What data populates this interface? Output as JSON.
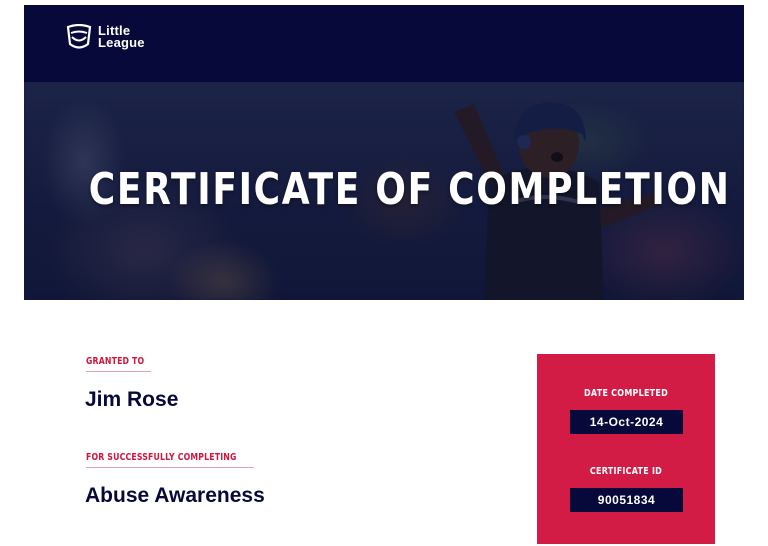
{
  "header": {
    "logo_line1": "Little",
    "logo_line2": "League"
  },
  "hero": {
    "title": "CERTIFICATE OF COMPLETION"
  },
  "certificate": {
    "granted_to_label": "GRANTED TO",
    "recipient_name": "Jim Rose",
    "completing_label": "FOR SUCCESSFULLY COMPLETING",
    "course_name": "Abuse Awareness"
  },
  "details": {
    "date_label": "DATE COMPLETED",
    "date_value": "14-Oct-2024",
    "id_label": "CERTIFICATE ID",
    "id_value": "90051834"
  },
  "colors": {
    "navy": "#06093a",
    "red": "#d31c45",
    "label_red": "#d0163e"
  }
}
